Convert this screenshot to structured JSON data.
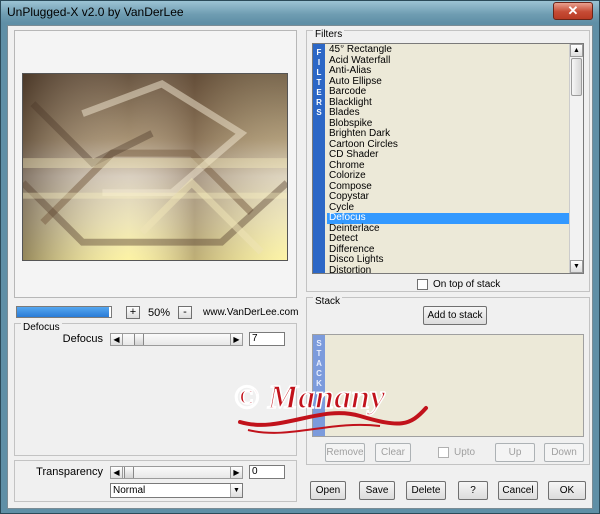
{
  "window": {
    "title": "UnPlugged-X v2.0 by VanDerLee",
    "close_label": "✕"
  },
  "preview": {
    "progress_fraction": 0.98,
    "zoom_minus": "-",
    "zoom_plus": "+",
    "zoom_value": "50%",
    "website": "www.VanDerLee.com"
  },
  "defocus_group": {
    "title": "Defocus",
    "param_label": "Defocus",
    "value": "7",
    "slider_fraction": 0.1
  },
  "transparency": {
    "label": "Transparency",
    "value": "0",
    "slider_fraction": 0.0,
    "blend_mode": "Normal"
  },
  "filters": {
    "group_title": "Filters",
    "side_label": "FILTERS",
    "items": [
      "45° Rectangle",
      "Acid Waterfall",
      "Anti-Alias",
      "Auto Ellipse",
      "Barcode",
      "Blacklight",
      "Blades",
      "Blobspike",
      "Brighten Dark",
      "Cartoon Circles",
      "CD Shader",
      "Chrome",
      "Colorize",
      "Compose",
      "Copystar",
      "Cycle",
      "Defocus",
      "Deinterlace",
      "Detect",
      "Difference",
      "Disco Lights",
      "Distortion"
    ],
    "selected": "Defocus",
    "on_top_label": "On top of stack"
  },
  "stack": {
    "group_title": "Stack",
    "add_label": "Add to stack",
    "side_label": "STACK",
    "remove_label": "Remove",
    "clear_label": "Clear",
    "upto_label": "Upto",
    "up_label": "Up",
    "down_label": "Down"
  },
  "footer": {
    "open": "Open",
    "save": "Save",
    "delete": "Delete",
    "help": "?",
    "cancel": "Cancel",
    "ok": "OK"
  },
  "watermark": {
    "text": "© Manany",
    "color": "#c1121b"
  },
  "colors": {
    "titlebar": "#6f9db2",
    "selection": "#3399ff",
    "filters_bar": "#2c67c6",
    "stack_bar": "#7c9bdc",
    "list_bg": "#ece9d8"
  }
}
